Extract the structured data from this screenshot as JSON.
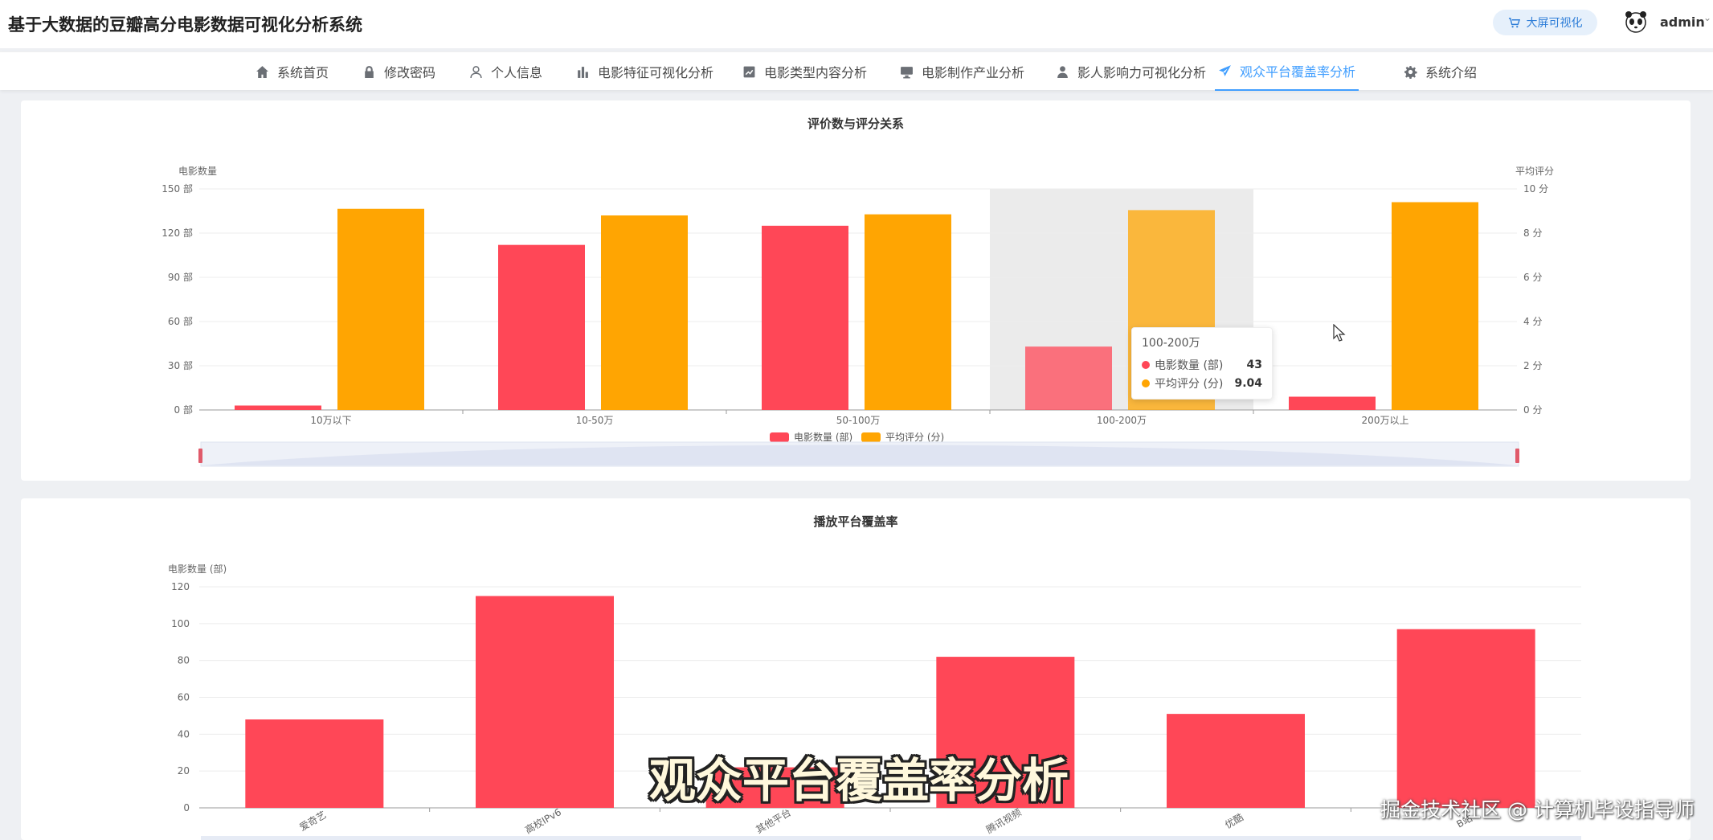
{
  "header": {
    "title": "基于大数据的豆瓣高分电影数据可视化分析系统",
    "bigscreen_label": "大屏可视化",
    "user_name": "admin"
  },
  "nav": [
    {
      "label": "系统首页",
      "icon": "home-icon"
    },
    {
      "label": "修改密码",
      "icon": "lock-icon"
    },
    {
      "label": "个人信息",
      "icon": "user-icon"
    },
    {
      "label": "电影特征可视化分析",
      "icon": "bar-chart-icon"
    },
    {
      "label": "电影类型内容分析",
      "icon": "chart-box-icon"
    },
    {
      "label": "电影制作产业分析",
      "icon": "monitor-icon"
    },
    {
      "label": "影人影响力可视化分析",
      "icon": "person-icon"
    },
    {
      "label": "观众平台覆盖率分析",
      "icon": "send-icon",
      "active": true
    },
    {
      "label": "系统介绍",
      "icon": "gear-icon"
    }
  ],
  "colors": {
    "red": "#ff4757",
    "orange": "#ffa502",
    "accent": "#409eff"
  },
  "chart_data": [
    {
      "type": "bar",
      "title": "评价数与评分关系",
      "ylabel_left": "电影数量",
      "ylabel_right": "平均评分",
      "categories": [
        "10万以下",
        "10-50万",
        "50-100万",
        "100-200万",
        "200万以上"
      ],
      "left_ticks": [
        "0 部",
        "30 部",
        "60 部",
        "90 部",
        "120 部",
        "150 部"
      ],
      "right_ticks": [
        "0 分",
        "2 分",
        "4 分",
        "6 分",
        "8 分",
        "10 分"
      ],
      "ylim_left": [
        0,
        150
      ],
      "ylim_right": [
        0,
        10
      ],
      "series": [
        {
          "name": "电影数量 (部)",
          "axis": "left",
          "values": [
            3,
            112,
            125,
            43,
            9
          ]
        },
        {
          "name": "平均评分 (分)",
          "axis": "right",
          "values": [
            9.1,
            8.8,
            8.85,
            9.04,
            9.4
          ]
        }
      ],
      "highlight_category": "100-200万",
      "legend_position": "bottom",
      "grid": true
    },
    {
      "type": "bar",
      "title": "播放平台覆盖率",
      "ylabel": "电影数量 (部)",
      "categories": [
        "爱奇艺",
        "高校IPv6",
        "其他平台",
        "腾讯视频",
        "优酷",
        "B站"
      ],
      "values": [
        48,
        115,
        22,
        82,
        51,
        97
      ],
      "ylim": [
        0,
        120
      ],
      "y_ticks": [
        "0",
        "20",
        "40",
        "60",
        "80",
        "100",
        "120"
      ],
      "grid": true
    }
  ],
  "tooltip": {
    "title": "100-200万",
    "rows": [
      {
        "label": "电影数量 (部)",
        "value": "43"
      },
      {
        "label": "平均评分 (分)",
        "value": "9.04"
      }
    ]
  },
  "overlay": {
    "subtitle": "观众平台覆盖率分析",
    "watermark": "掘金技术社区 @ 计算机毕设指导师"
  }
}
